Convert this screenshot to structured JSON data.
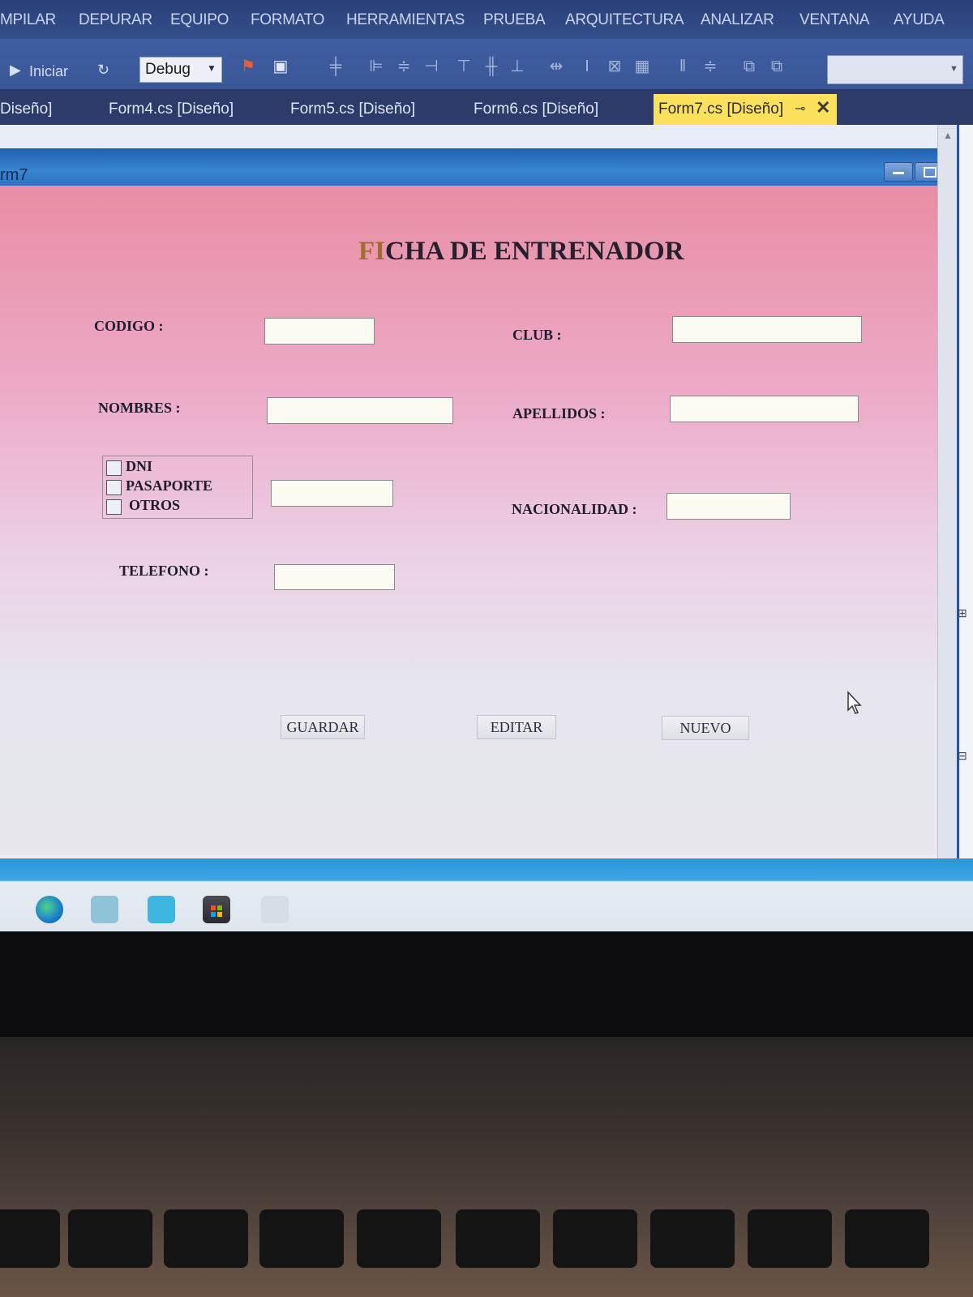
{
  "menubar": {
    "items": [
      "MPILAR",
      "DEPURAR",
      "EQUIPO",
      "FORMATO",
      "HERRAMIENTAS",
      "PRUEBA",
      "ARQUITECTURA",
      "ANALIZAR",
      "VENTANA",
      "AYUDA"
    ]
  },
  "toolbar": {
    "start_label": "Iniciar",
    "config_value": "Debug"
  },
  "tabs": {
    "items": [
      "Diseño]",
      "Form4.cs [Diseño]",
      "Form5.cs [Diseño]",
      "Form6.cs [Diseño]"
    ],
    "active": "Form7.cs [Diseño]"
  },
  "form": {
    "window_title": "rm7",
    "title_prefix": "FI",
    "title_rest": "CHA DE ENTRENADOR",
    "labels": {
      "codigo": "CODIGO :",
      "club": "CLUB :",
      "nombres": "NOMBRES :",
      "apellidos": "APELLIDOS :",
      "nacionalidad": "NACIONALIDAD :",
      "telefono": "TELEFONO :"
    },
    "document_options": [
      "DNI",
      "PASAPORTE",
      "OTROS"
    ],
    "buttons": {
      "guardar": "GUARDAR",
      "editar": "EDITAR",
      "nuevo": "NUEVO"
    }
  },
  "colors": {
    "menubar": "#2a3f7a",
    "active_tab": "#fce15c",
    "form_top": "#e88ea4",
    "form_bottom": "#e6e6ec"
  }
}
